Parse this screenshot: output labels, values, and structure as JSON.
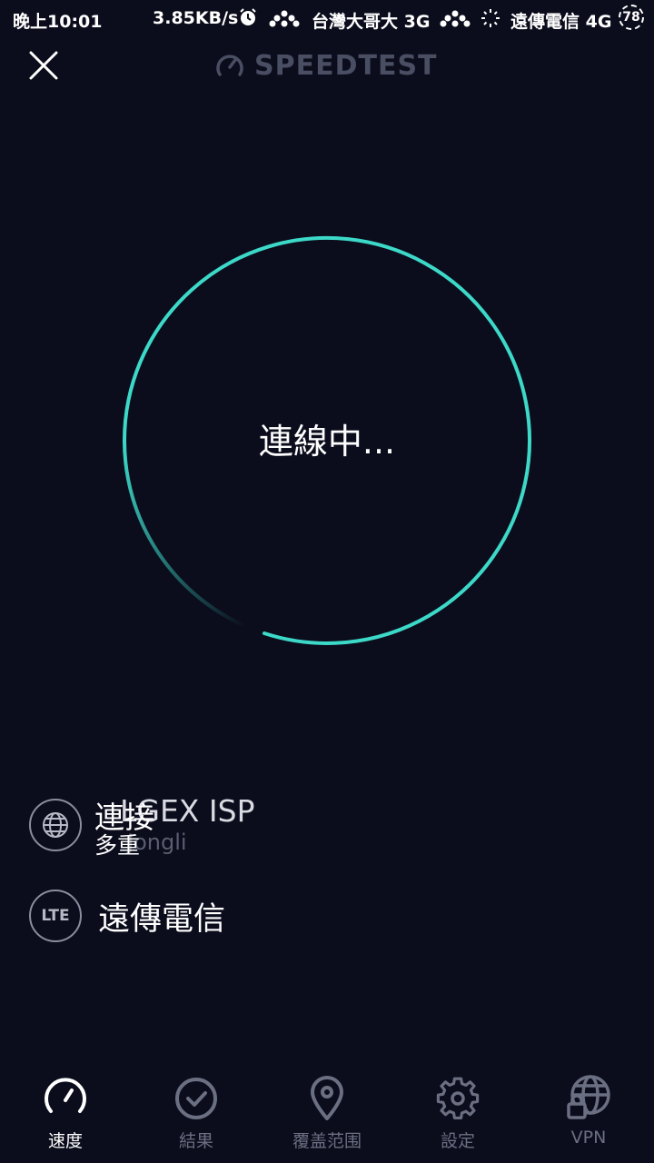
{
  "status_bar": {
    "time": "晚上10:01",
    "net_speed": "3.85KB/s",
    "carrier1": "台灣大哥大 3G",
    "carrier2": "遠傳電信 4G",
    "battery": "78"
  },
  "header": {
    "brand": "SPEEDTEST",
    "close_icon": "close-icon",
    "brand_icon": "gauge-icon"
  },
  "gauge": {
    "status_text": "連線中...",
    "accent_color": "#3dd9c8"
  },
  "connection": {
    "label": "連接",
    "mode": "多重",
    "isp": "LGEX ISP",
    "isp_sub": "Jongli",
    "icon": "globe-icon"
  },
  "network": {
    "badge": "LTE",
    "carrier": "遠傳電信"
  },
  "bottom_nav": {
    "items": [
      {
        "label": "速度",
        "icon": "speed-gauge-icon",
        "active": true
      },
      {
        "label": "結果",
        "icon": "check-circle-icon",
        "active": false
      },
      {
        "label": "覆盖范围",
        "icon": "map-pin-icon",
        "active": false
      },
      {
        "label": "設定",
        "icon": "gear-icon",
        "active": false
      },
      {
        "label": "VPN",
        "icon": "vpn-lock-icon",
        "active": false
      }
    ]
  }
}
